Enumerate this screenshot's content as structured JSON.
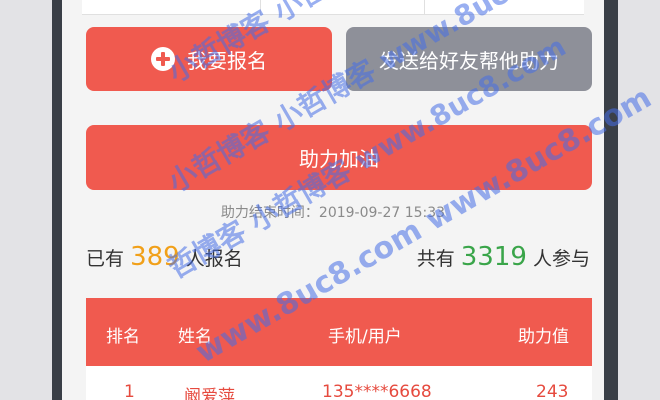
{
  "buttons": {
    "signup_label": "我要报名",
    "share_label": "发送给好友帮他助力",
    "boost_label": "助力加油"
  },
  "deadline": "助力结束时间：2019-09-27 15:33",
  "stats": {
    "left_prefix": "已有",
    "signup_count": "389",
    "left_suffix": "人报名",
    "right_prefix": "共有",
    "participant_count": "3319",
    "right_suffix": "人参与"
  },
  "table": {
    "headers": [
      "排名",
      "姓名",
      "手机/用户",
      "助力值"
    ],
    "rows": [
      {
        "rank": "1",
        "name": "阚爱萍",
        "phone": "135****6668",
        "value": "243"
      }
    ]
  },
  "watermarks": [
    "小哲博客 小哲博客 小哲博客",
    "小哲博客 小哲博客 www.8uc8.com",
    "哲博客 小哲博客 www.8uc8.com",
    "www.8uc8.com www.8uc8.com"
  ],
  "colors": {
    "primary_red": "#f05a4f",
    "gray_button": "#8e9099",
    "orange_number": "#f1a019",
    "green_number": "#3aa54a",
    "watermark_blue": "#466ee6"
  }
}
